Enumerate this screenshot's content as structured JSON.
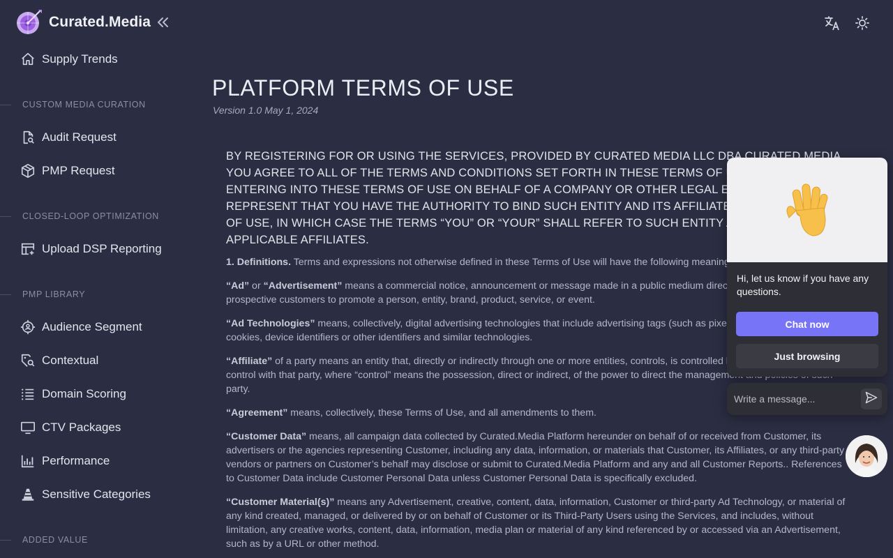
{
  "brand": {
    "name": "Curated.Media",
    "collapse_icon": "double-chevron-left-icon"
  },
  "sidebar": {
    "top_item": {
      "label": "Supply Trends",
      "icon": "home-icon"
    },
    "sections": [
      {
        "title": "CUSTOM MEDIA CURATION",
        "items": [
          {
            "label": "Audit Request",
            "icon": "document-search-icon"
          },
          {
            "label": "PMP Request",
            "icon": "cube-icon"
          }
        ]
      },
      {
        "title": "CLOSED-LOOP OPTIMIZATION",
        "items": [
          {
            "label": "Upload DSP Reporting",
            "icon": "table-add-icon"
          }
        ]
      },
      {
        "title": "PMP LIBRARY",
        "items": [
          {
            "label": "Audience Segment",
            "icon": "target-person-icon"
          },
          {
            "label": "Contextual",
            "icon": "tag-search-icon"
          },
          {
            "label": "Domain Scoring",
            "icon": "list-icon"
          },
          {
            "label": "CTV Packages",
            "icon": "tv-icon"
          },
          {
            "label": "Performance",
            "icon": "bar-chart-icon"
          },
          {
            "label": "Sensitive Categories",
            "icon": "cone-icon"
          }
        ]
      },
      {
        "title": "ADDED VALUE",
        "items": []
      }
    ]
  },
  "topbar": {
    "icons": [
      "translate-icon",
      "sun-icon"
    ]
  },
  "page": {
    "title": "PLATFORM TERMS OF USE",
    "version": "Version 1.0 May 1, 2024",
    "lead": "BY REGISTERING FOR OR USING THE SERVICES, PROVIDED BY CURATED MEDIA LLC DBA CURATED MEDIA YOU AGREE TO ALL OF THE TERMS AND CONDITIONS SET FORTH IN THESE TERMS OF USE. IF YOU ARE ENTERING INTO THESE TERMS OF USE ON BEHALF OF A COMPANY OR OTHER LEGAL ENTITY, YOU REPRESENT THAT YOU HAVE THE AUTHORITY TO BIND SUCH ENTITY AND ITS AFFILIATES TO THESE TERMS OF USE, IN WHICH CASE THE TERMS “YOU” OR “YOUR” SHALL REFER TO SUCH ENTITY AND ITS APPLICABLE AFFILIATES.",
    "paragraphs": [
      {
        "term": "1. Definitions.",
        "text": " Terms and expressions not otherwise defined in these Terms of Use will have the following meanings:"
      },
      {
        "term": "“Ad”",
        "mid": " or ",
        "term2": "“Advertisement”",
        "text": " means a commercial notice, announcement or message made in a public medium directed to customers or prospective customers to promote a person, entity, brand, product, service, or event."
      },
      {
        "term": "“Ad Technologies”",
        "text": " means, collectively, digital advertising technologies that include advertising tags (such as pixels or similar methods), cookies, device identifiers or other identifiers and similar technologies."
      },
      {
        "term": "“Affiliate”",
        "text": " of a party means an entity that, directly or indirectly through one or more entities, controls, is controlled by or is under common control with that party, where “control” means the possession, direct or indirect, of the power to direct the management and policies of such party."
      },
      {
        "term": "“Agreement”",
        "text": " means, collectively, these Terms of Use, and all amendments to them."
      },
      {
        "term": "“Customer Data”",
        "text": " means, all campaign data collected by Curated.Media Platform hereunder on behalf of or received from Customer, its advertisers or the agencies representing Customer, including any data, information, or materials that Customer, its Affiliates, or any third-party vendors or partners on Customer’s behalf may disclose or submit to Curated.Media Platform and any and all Customer Reports.. References to Customer Data include Customer Personal Data unless Customer Personal Data is specifically excluded."
      },
      {
        "term": "“Customer Material(s)”",
        "text": " means any Advertisement, creative, content, data, information, Customer or third-party Ad Technology, or material of any kind created, managed, or delivered by or on behalf of Customer or its Third-Party Users using the Services, and includes, without limitation, any creative works, content, data, information, media plan or material of any kind referenced by or accessed via an Advertisement, such as by a URL or other method."
      }
    ]
  },
  "chat": {
    "message": "Hi, let us know if you have any questions.",
    "primary_button": "Chat now",
    "secondary_button": "Just browsing",
    "input_placeholder": "Write a message...",
    "send_icon": "send-icon",
    "hero_icon": "waving-hand-icon"
  },
  "colors": {
    "background": "#2b2d42",
    "accent": "#7774f7",
    "chat_card": "#2e2f36"
  }
}
